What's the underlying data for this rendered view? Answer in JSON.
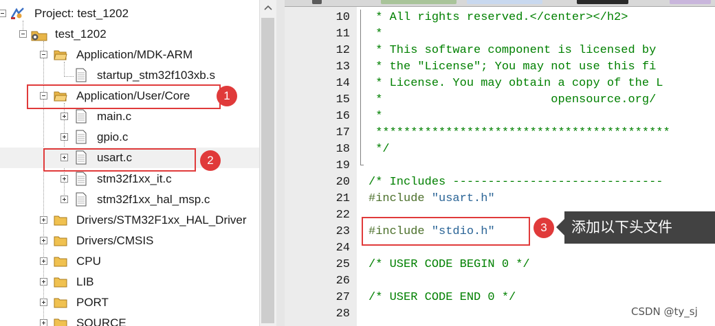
{
  "project_tree": {
    "root_label": "Project: test_1202",
    "target_label": "test_1202",
    "items": [
      {
        "label": "Application/MDK-ARM",
        "type": "folder"
      },
      {
        "label": "startup_stm32f103xb.s",
        "type": "file"
      },
      {
        "label": "Application/User/Core",
        "type": "folder"
      },
      {
        "label": "main.c",
        "type": "file"
      },
      {
        "label": "gpio.c",
        "type": "file"
      },
      {
        "label": "usart.c",
        "type": "file"
      },
      {
        "label": "stm32f1xx_it.c",
        "type": "file"
      },
      {
        "label": "stm32f1xx_hal_msp.c",
        "type": "file"
      },
      {
        "label": "Drivers/STM32F1xx_HAL_Driver",
        "type": "folder"
      },
      {
        "label": "Drivers/CMSIS",
        "type": "folder"
      },
      {
        "label": "CPU",
        "type": "folder"
      },
      {
        "label": "LIB",
        "type": "folder"
      },
      {
        "label": "PORT",
        "type": "folder"
      },
      {
        "label": "SOURCE",
        "type": "folder"
      }
    ]
  },
  "editor": {
    "lines": [
      {
        "no": "10",
        "text": " * All rights reserved.</center></h2>"
      },
      {
        "no": "11",
        "text": " *"
      },
      {
        "no": "12",
        "text": " * This software component is licensed by"
      },
      {
        "no": "13",
        "text": " * the \"License\"; You may not use this fi"
      },
      {
        "no": "14",
        "text": " * License. You may obtain a copy of the L"
      },
      {
        "no": "15",
        "text": " *                        opensource.org/"
      },
      {
        "no": "16",
        "text": " *"
      },
      {
        "no": "17",
        "text": " ******************************************"
      },
      {
        "no": "18",
        "text": " */"
      },
      {
        "no": "19",
        "text": ""
      },
      {
        "no": "20",
        "text": "/* Includes ------------------------------"
      },
      {
        "no": "21",
        "pre": "#include",
        "str": "\"usart.h\""
      },
      {
        "no": "22",
        "text": ""
      },
      {
        "no": "23",
        "pre": "#include",
        "str": "\"stdio.h\""
      },
      {
        "no": "24",
        "text": ""
      },
      {
        "no": "25",
        "text": "/* USER CODE BEGIN 0 */"
      },
      {
        "no": "26",
        "text": ""
      },
      {
        "no": "27",
        "text": "/* USER CODE END 0 */"
      },
      {
        "no": "28",
        "text": ""
      }
    ]
  },
  "annotations": {
    "badge_1": "1",
    "badge_2": "2",
    "badge_3": "3",
    "tooltip": "添加以下头文件"
  },
  "watermark": "CSDN @ty_sj",
  "colors": {
    "annotation_red": "#e03a3a",
    "comment_green": "#008000",
    "string_blue": "#2a6496",
    "tooltip_bg": "#424242"
  }
}
